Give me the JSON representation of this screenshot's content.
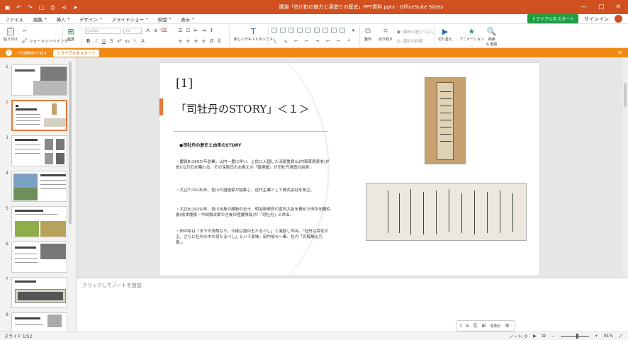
{
  "window": {
    "title": "講演「佐川町の魅力と酒造りの歴史」PPT資料.pptx - OfficeSuite Slides",
    "controls": [
      "—",
      "□",
      "✕"
    ]
  },
  "quick_access": [
    "save-icon",
    "undo-icon",
    "redo-icon",
    "new-icon",
    "print-icon",
    "share-icon",
    "cursor-icon"
  ],
  "menu": {
    "items": [
      "ファイル",
      "編集",
      "挿入",
      "デザイン",
      "スライドショー",
      "校閲",
      "表示"
    ],
    "trial_button": "トライアルをスタート",
    "signin": "サインイン"
  },
  "ribbon": {
    "paste": "貼り付け",
    "cut_icon": "cut-icon",
    "format_painter": "フォーマットペインター",
    "new_slide": "新規",
    "font_name": "Calibri",
    "font_size": "12",
    "new_textbox": "新しいテキストボックス",
    "arrange": "整列",
    "crop": "切り取り",
    "shape_fill": "図形の塗りつぶし",
    "shape_outline": "図形の枠線",
    "transition": "切り替え",
    "animation": "アニメーション",
    "find_replace": "検索\n& 置換"
  },
  "banner": {
    "text": "7日間無料で試す",
    "button": "トライアルをスタート",
    "close": "✕"
  },
  "thumbnails": [
    {
      "num": "1"
    },
    {
      "num": "2"
    },
    {
      "num": "3"
    },
    {
      "num": "4"
    },
    {
      "num": "5"
    },
    {
      "num": "6"
    },
    {
      "num": "7"
    },
    {
      "num": "8"
    }
  ],
  "slide": {
    "number_label": "[1]",
    "heading": "「司牡丹のSTORY」＜１＞",
    "subheading": "●司牡丹の歴史と由来のSTORY",
    "paragraphs": [
      "・慶長8(1603)年創業。山内一豊に伴い、土佐に入国した深尾重良(山内家首席家老)が佐川1万石を賜わる。その深尾氏のお抱えの「御酒屋」が司牡丹酒造の前身。",
      "・大正7(1918)年、佐川の酒造家が結集し、近代企業として株式会社を設立。",
      "・大正8(1919)年、佐川出身の維新の志士、明治新政府の宮内大臣を務めた田中光顕伯爵(坂本龍馬・中岡慎太郎亡き後の陸援隊長)が「司牡丹」と命名。",
      "・田中伯は「天下の芳醇なり、今後は酒の王たるべし」と激励し命名。「牡丹は百花の王、さらに牡丹の中の司たるべし」という意味。田中伯の一筆、牡丹「芳醇無比乃香」。"
    ],
    "scroll_text": "芳醇無比乃香"
  },
  "notes": {
    "placeholder": "クリックしてノートを追加"
  },
  "float_toolbar": [
    "I",
    "A",
    "⎘",
    "⊞",
    "非表示",
    "⚙"
  ],
  "status": {
    "slide_info": "スライド 1/52",
    "notes_label": "ノート: 0",
    "zoom": "91%"
  }
}
